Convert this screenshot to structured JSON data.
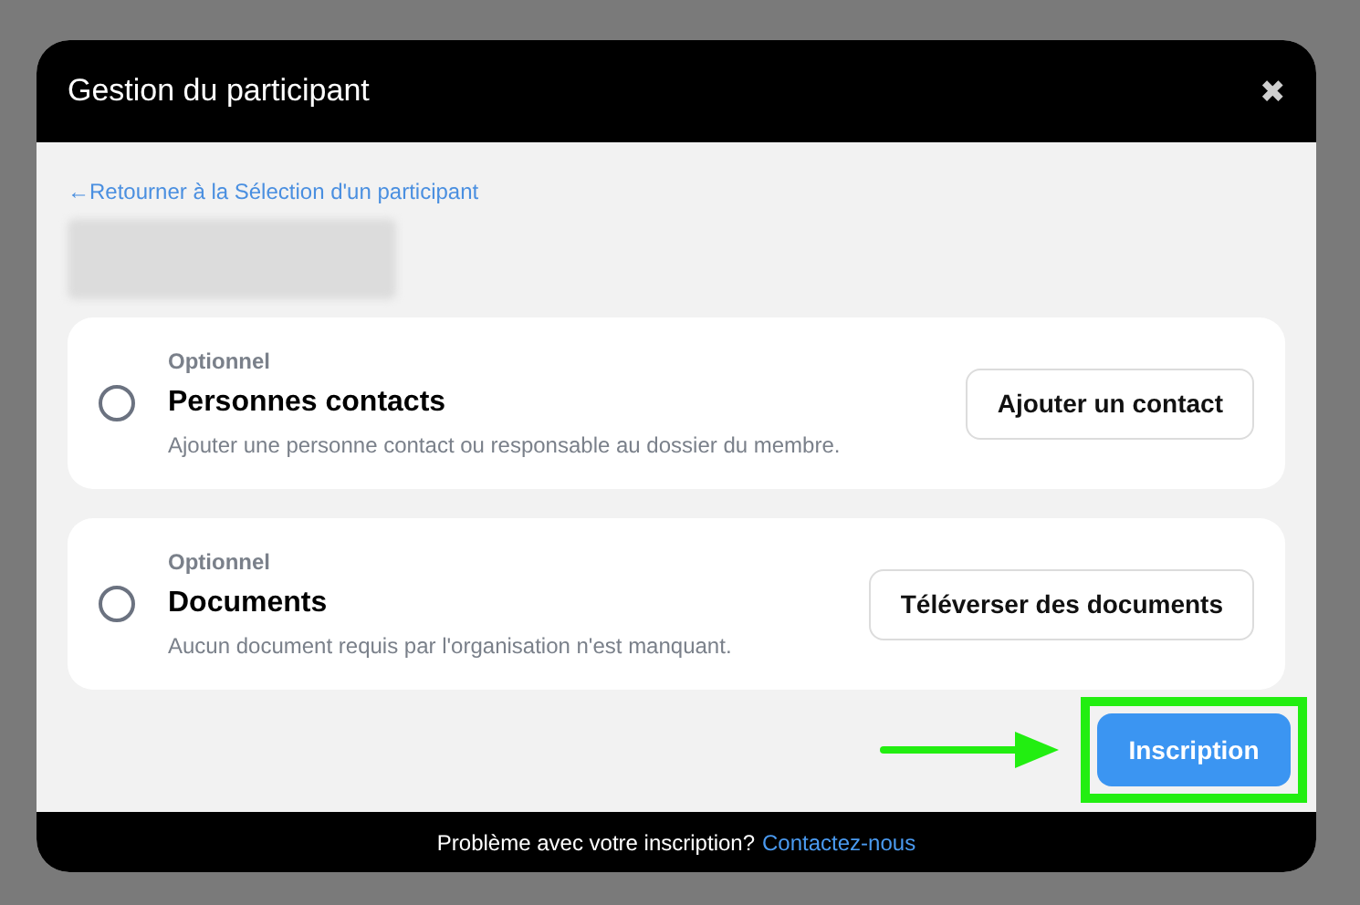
{
  "dialog": {
    "title": "Gestion du participant",
    "close": "✖"
  },
  "back_link": "←Retourner à la Sélection d'un participant",
  "tasks": [
    {
      "tag": "Optionnel",
      "title": "Personnes contacts",
      "description": "Ajouter une personne contact ou responsable au dossier du membre.",
      "checked": false,
      "action": "Ajouter un contact"
    },
    {
      "tag": "Optionnel",
      "title": "Documents",
      "description": "Aucun document requis par l'organisation n'est manquant.",
      "checked": false,
      "action": "Téléverser des documents"
    }
  ],
  "submit": "Inscription",
  "footer": {
    "text": "Problème avec votre inscription?",
    "link": "Contactez-nous"
  }
}
